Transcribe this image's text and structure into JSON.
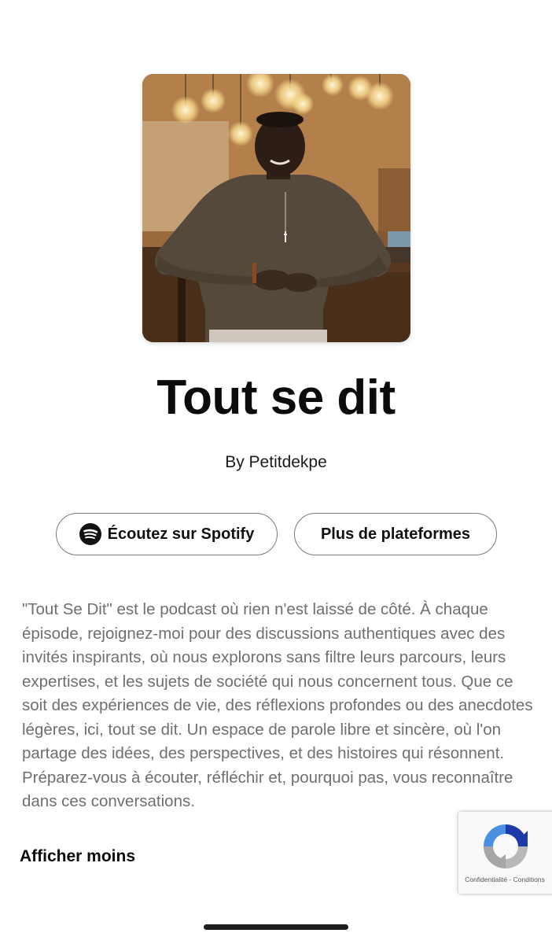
{
  "podcast": {
    "title": "Tout se dit",
    "byline": "By Petitdekpe",
    "cover_icon": "podcast-cover-photo"
  },
  "actions": {
    "spotify_label": "Écoutez sur Spotify",
    "spotify_icon": "spotify-icon",
    "more_platforms_label": "Plus de plateformes"
  },
  "description": {
    "text": "\"Tout Se Dit\" est le podcast où rien n'est laissé de côté. À chaque épisode, rejoignez-moi pour des discussions authentiques avec des invités inspirants, où nous explorons sans filtre leurs parcours, leurs expertises, et les sujets de société qui nous concernent tous. Que ce soit des expériences de vie, des réflexions profondes ou des anecdotes légères, ici, tout se dit. Un espace de parole libre et sincère, où l'on partage des idées, des perspectives, et des histoires qui résonnent. Préparez-vous à écouter, réfléchir et, pourquoi pas, vous reconnaître dans ces conversations.",
    "toggle_label": "Afficher moins"
  },
  "recaptcha": {
    "icon": "recaptcha-icon",
    "links": "Confidentialité - Conditions"
  },
  "colors": {
    "text": "#111111",
    "muted_text": "#6f6f6f",
    "button_border": "#7a7a7a",
    "recaptcha_blue": "#1c3aa9",
    "recaptcha_light_blue": "#4a90e2",
    "recaptcha_gray": "#a6a6a6"
  }
}
